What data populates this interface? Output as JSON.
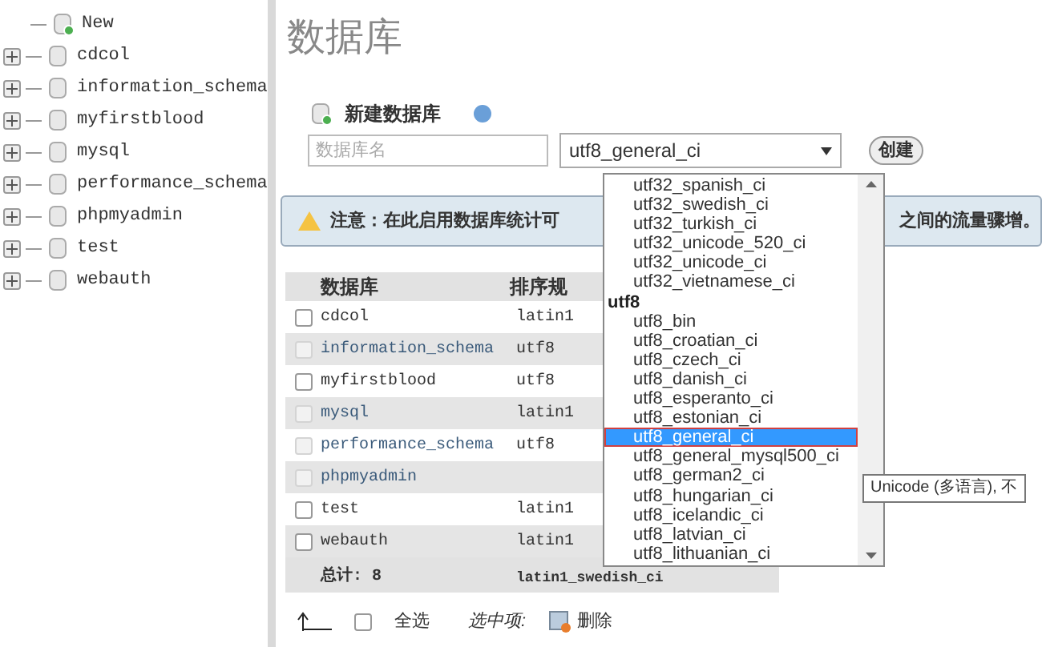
{
  "sidebar": {
    "items": [
      {
        "label": "New",
        "kind": "new"
      },
      {
        "label": "cdcol",
        "kind": "db"
      },
      {
        "label": "information_schema",
        "kind": "db"
      },
      {
        "label": "myfirstblood",
        "kind": "db"
      },
      {
        "label": "mysql",
        "kind": "db"
      },
      {
        "label": "performance_schema",
        "kind": "db"
      },
      {
        "label": "phpmyadmin",
        "kind": "db"
      },
      {
        "label": "test",
        "kind": "db"
      },
      {
        "label": "webauth",
        "kind": "db"
      }
    ]
  },
  "heading": "数据库",
  "create": {
    "title": "新建数据库",
    "name_placeholder": "数据库名",
    "collation": "utf8_general_ci",
    "button": "创建"
  },
  "notice": {
    "text_start": "注意：在此启用数据库统计可",
    "text_end": "之间的流量骤增。"
  },
  "table": {
    "columns": [
      "数据库",
      "排序规"
    ],
    "rows": [
      {
        "name": "cdcol",
        "collation": "latin1",
        "disabled": false
      },
      {
        "name": "information_schema",
        "collation": "utf8",
        "disabled": true
      },
      {
        "name": "myfirstblood",
        "collation": "utf8",
        "disabled": false
      },
      {
        "name": "mysql",
        "collation": "latin1",
        "disabled": true
      },
      {
        "name": "performance_schema",
        "collation": "utf8",
        "disabled": true
      },
      {
        "name": "phpmyadmin",
        "collation": "",
        "disabled": true
      },
      {
        "name": "test",
        "collation": "latin1",
        "disabled": false
      },
      {
        "name": "webauth",
        "collation": "latin1",
        "disabled": false
      }
    ],
    "total_label": "总计: 8",
    "total_collation": "latin1_swedish_ci"
  },
  "footer": {
    "select_all_checked": false,
    "select_all": "全选",
    "with_selected": "选中项:",
    "delete": "删除"
  },
  "dropdown": {
    "options": [
      {
        "label": "utf32_spanish_ci",
        "kind": "option",
        "selected": false
      },
      {
        "label": "utf32_swedish_ci",
        "kind": "option",
        "selected": false
      },
      {
        "label": "utf32_turkish_ci",
        "kind": "option",
        "selected": false
      },
      {
        "label": "utf32_unicode_520_ci",
        "kind": "option",
        "selected": false
      },
      {
        "label": "utf32_unicode_ci",
        "kind": "option",
        "selected": false
      },
      {
        "label": "utf32_vietnamese_ci",
        "kind": "option",
        "selected": false
      },
      {
        "label": "utf8",
        "kind": "group"
      },
      {
        "label": "utf8_bin",
        "kind": "option",
        "selected": false
      },
      {
        "label": "utf8_croatian_ci",
        "kind": "option",
        "selected": false
      },
      {
        "label": "utf8_czech_ci",
        "kind": "option",
        "selected": false
      },
      {
        "label": "utf8_danish_ci",
        "kind": "option",
        "selected": false
      },
      {
        "label": "utf8_esperanto_ci",
        "kind": "option",
        "selected": false
      },
      {
        "label": "utf8_estonian_ci",
        "kind": "option",
        "selected": false
      },
      {
        "label": "utf8_general_ci",
        "kind": "option",
        "selected": true
      },
      {
        "label": "utf8_general_mysql500_ci",
        "kind": "option",
        "selected": false
      },
      {
        "label": "utf8_german2_ci",
        "kind": "option",
        "selected": false
      },
      {
        "label": "utf8_hungarian_ci",
        "kind": "option",
        "selected": false
      },
      {
        "label": "utf8_icelandic_ci",
        "kind": "option",
        "selected": false
      },
      {
        "label": "utf8_latvian_ci",
        "kind": "option",
        "selected": false
      },
      {
        "label": "utf8_lithuanian_ci",
        "kind": "option",
        "selected": false
      }
    ],
    "tooltip": "Unicode (多语言), 不"
  }
}
